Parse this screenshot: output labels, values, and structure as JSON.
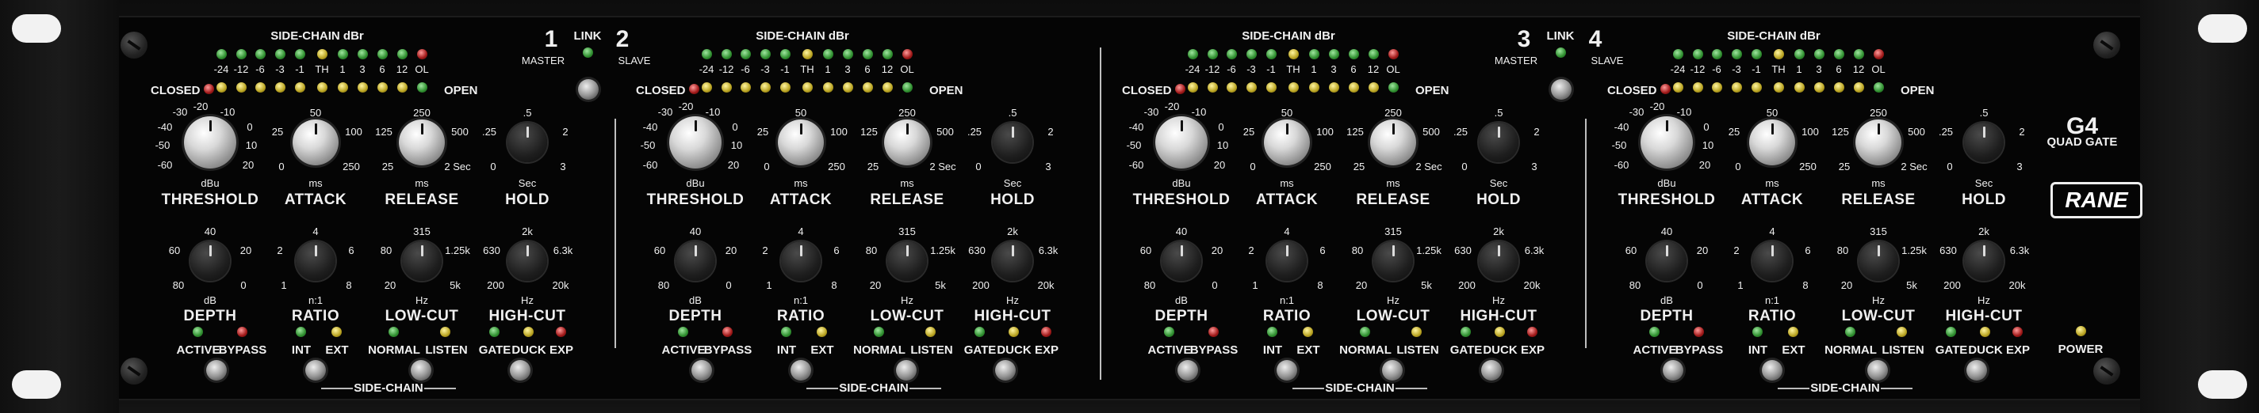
{
  "product": {
    "model": "G4",
    "subtitle": "QUAD GATE",
    "brand": "RANE",
    "power_label": "POWER"
  },
  "link_labels": {
    "link": "LINK",
    "master": "MASTER",
    "slave": "SLAVE",
    "pair1_left": "1",
    "pair1_right": "2",
    "pair2_left": "3",
    "pair2_right": "4"
  },
  "meter": {
    "title": "SIDE-CHAIN dBr",
    "scale": [
      "-24",
      "-12",
      "-6",
      "-3",
      "-1",
      "TH",
      "1",
      "3",
      "6",
      "12",
      "OL"
    ],
    "closed_label": "CLOSED",
    "open_label": "OPEN"
  },
  "knob_scales": {
    "threshold": [
      "-30",
      "-20",
      "-10",
      "0",
      "-40",
      "10",
      "-50",
      "20",
      "-60",
      "dBu"
    ],
    "attack": [
      "50",
      "25",
      "100",
      "0",
      "250",
      "ms"
    ],
    "release": [
      "250",
      "125",
      "500",
      "25",
      "2 Sec",
      "ms"
    ],
    "hold": [
      ".5",
      ".25",
      "2",
      "0",
      "3",
      "Sec"
    ],
    "depth": [
      "40",
      "60",
      "20",
      "80",
      "0",
      "dB"
    ],
    "ratio": [
      "4",
      "2",
      "6",
      "1",
      "8",
      "n:1"
    ],
    "lowcut": [
      "315",
      "80",
      "1.25k",
      "20",
      "5k",
      "Hz"
    ],
    "highcut": [
      "2k",
      "630",
      "6.3k",
      "200",
      "20k",
      "Hz"
    ]
  },
  "knob_labels": {
    "threshold": "THRESHOLD",
    "attack": "ATTACK",
    "release": "RELEASE",
    "hold": "HOLD",
    "depth": "DEPTH",
    "ratio": "RATIO",
    "lowcut": "LOW-CUT",
    "highcut": "HIGH-CUT"
  },
  "switch_labels": {
    "active": "ACTIVE",
    "bypass": "BYPASS",
    "int": "INT",
    "ext": "EXT",
    "normal": "NORMAL",
    "listen": "LISTEN",
    "gate": "GATE",
    "duck": "DUCK",
    "exp": "EXP",
    "side_chain": "SIDE-CHAIN"
  }
}
